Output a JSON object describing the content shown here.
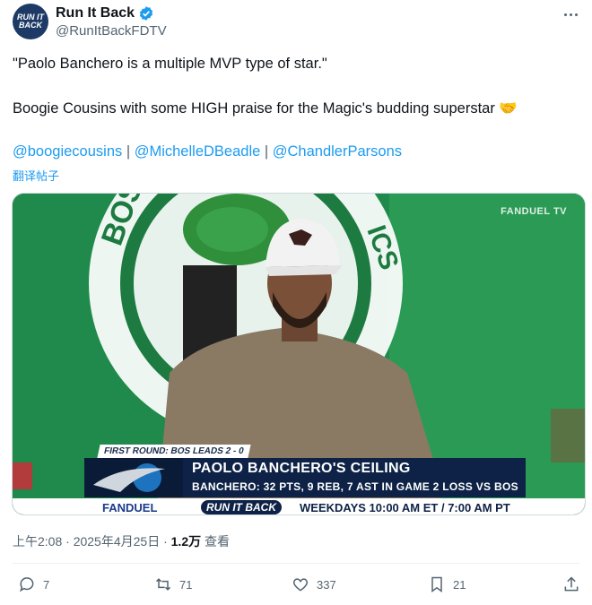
{
  "author": {
    "avatar_text": "RUN IT BACK",
    "display_name": "Run It Back",
    "handle": "@RunItBackFDTV",
    "verified_icon": "verified-badge-icon",
    "more_icon": "more-dots-icon"
  },
  "tweet": {
    "line1": "\"Paolo Banchero is a multiple MVP type of star.\"",
    "line2": "Boogie Cousins with some HIGH praise for the Magic's budding superstar 🤝",
    "mentions": [
      "@boogiecousins",
      "@MichelleDBeadle",
      "@ChandlerParsons"
    ],
    "separator": " | ",
    "translate": "翻译帖子"
  },
  "media": {
    "watermark": "FANDUEL TV",
    "round_tag": "FIRST ROUND: BOS LEADS 2 - 0",
    "headline": "PAOLO BANCHERO'S CEILING",
    "subline": "BANCHERO: 32 PTS, 9 REB, 7 AST IN GAME 2 LOSS VS BOS",
    "fanduel": "FANDUEL",
    "show_logo": "RUN IT BACK",
    "schedule": "WEEKDAYS 10:00 AM ET / 7:00 AM PT"
  },
  "meta": {
    "time": "上午2:08 · 2025年4月25日 · ",
    "views": "1.2万",
    "views_label": " 查看"
  },
  "actions": {
    "reply": "7",
    "retweet": "71",
    "like": "337",
    "bookmark": "21"
  },
  "colors": {
    "link": "#1d9bf0",
    "secondary": "#536471",
    "studio_green": "#1f8a4c"
  }
}
